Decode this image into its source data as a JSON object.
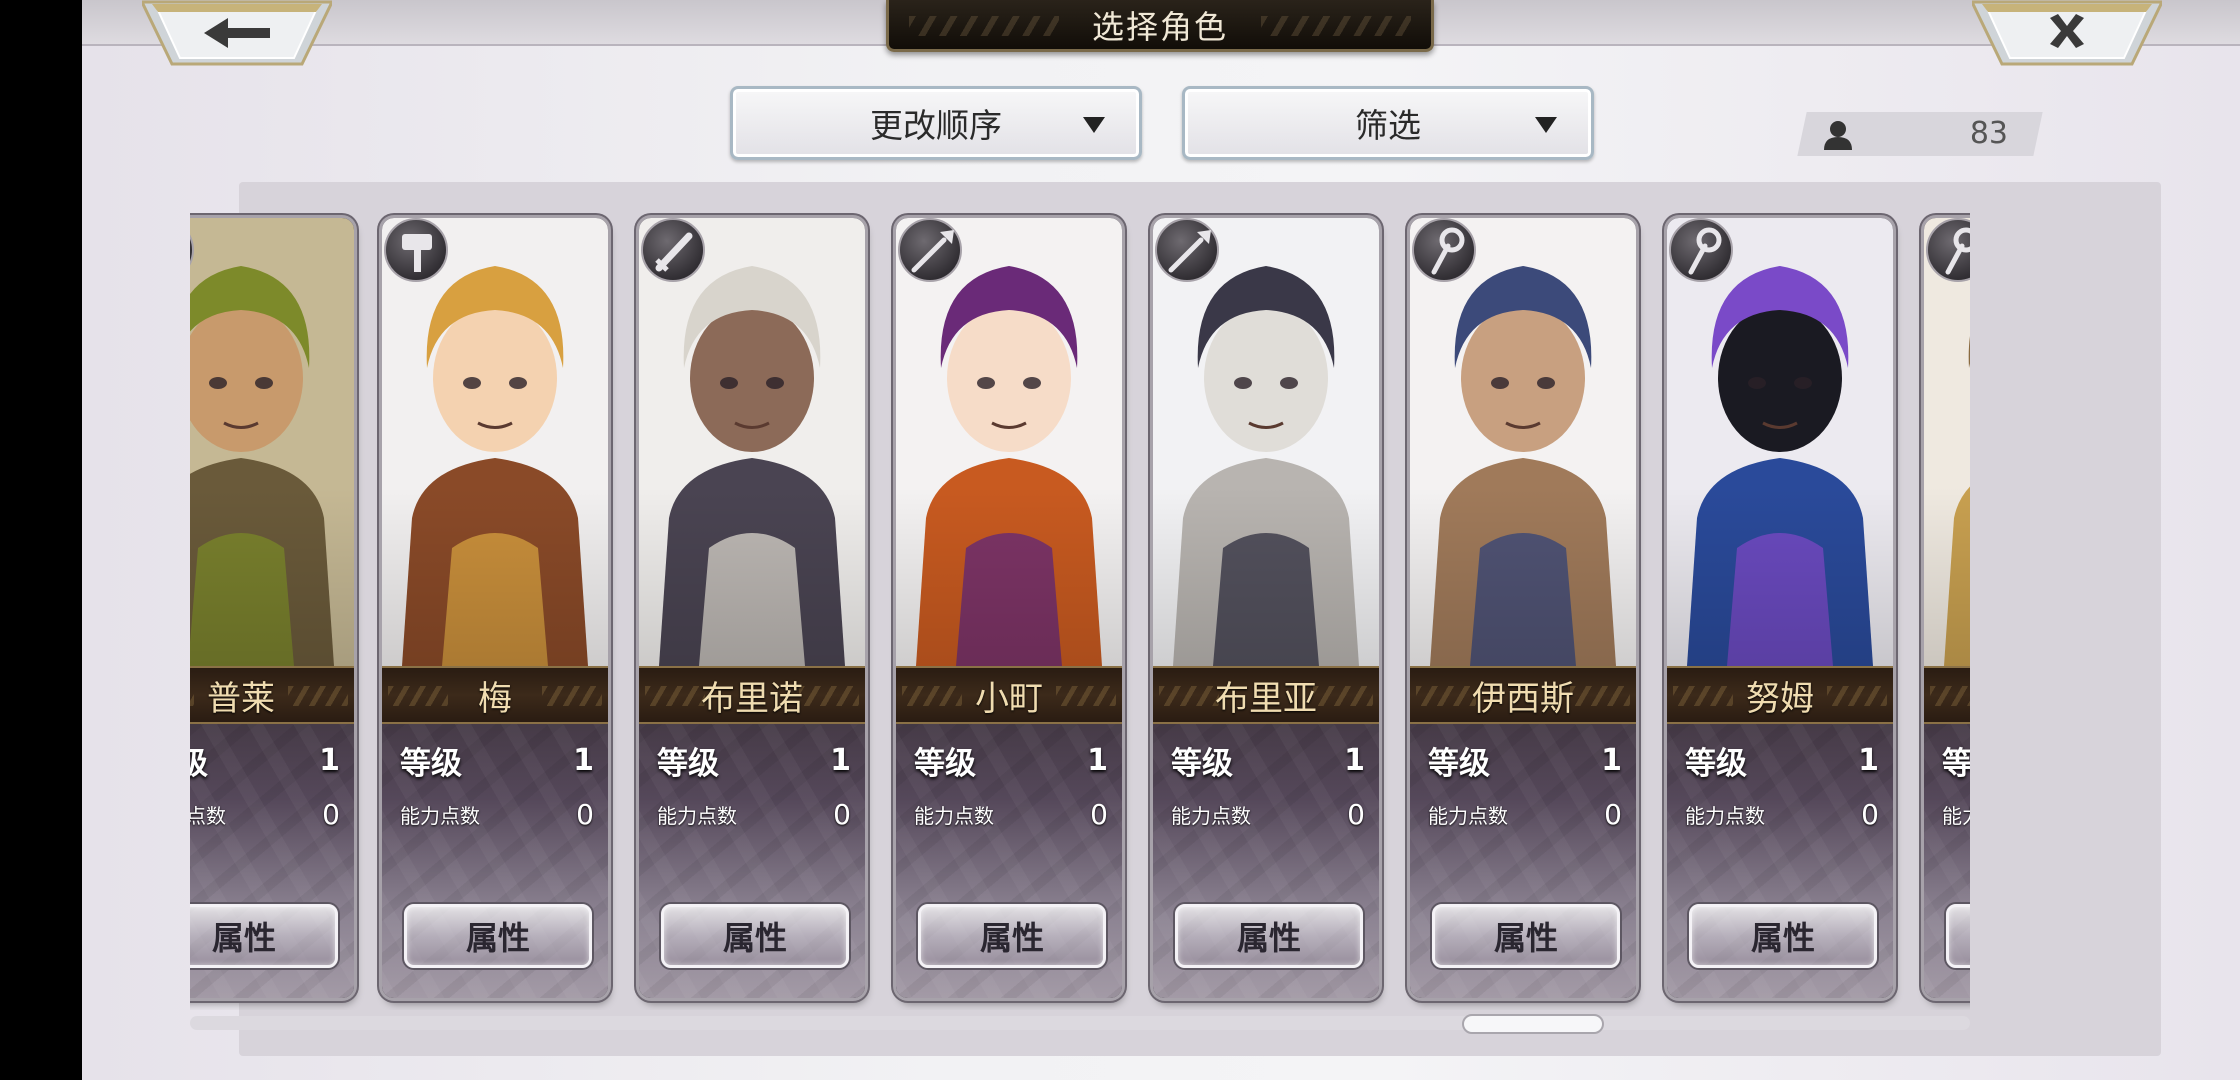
{
  "header": {
    "title": "选择角色",
    "back_icon": "arrow-left",
    "close_icon": "close-x"
  },
  "controls": {
    "sort_label": "更改顺序",
    "filter_label": "筛选"
  },
  "counter": {
    "icon": "person-icon",
    "value": "83"
  },
  "card_labels": {
    "level": "等级",
    "ability_points": "能力点数",
    "attributes_button": "属性"
  },
  "characters": [
    {
      "name": "普莱",
      "level": "1",
      "ability_points": "0",
      "weapon_icon": "spear-icon",
      "portrait": {
        "bg": "#c5b894",
        "main": "#6a5a3a",
        "accent": "#7d8a2a",
        "skin": "#c89a6c"
      }
    },
    {
      "name": "梅",
      "level": "1",
      "ability_points": "0",
      "weapon_icon": "hammer-icon",
      "portrait": {
        "bg": "#f2f0f0",
        "main": "#8a4a28",
        "accent": "#d8a040",
        "skin": "#f4d2b0"
      }
    },
    {
      "name": "布里诺",
      "level": "1",
      "ability_points": "0",
      "weapon_icon": "sword-icon",
      "portrait": {
        "bg": "#f0eeec",
        "main": "#4a4452",
        "accent": "#d8d4cc",
        "skin": "#8c6a58"
      }
    },
    {
      "name": "小町",
      "level": "1",
      "ability_points": "0",
      "weapon_icon": "spear-icon",
      "portrait": {
        "bg": "#f4f2f2",
        "main": "#c85a20",
        "accent": "#6a2a78",
        "skin": "#f6dcc8"
      }
    },
    {
      "name": "布里亚",
      "level": "1",
      "ability_points": "0",
      "weapon_icon": "spear-icon",
      "portrait": {
        "bg": "#f2f2f4",
        "main": "#b8b4b0",
        "accent": "#3a3848",
        "skin": "#e0ddd8"
      }
    },
    {
      "name": "伊西斯",
      "level": "1",
      "ability_points": "0",
      "weapon_icon": "staff-icon",
      "portrait": {
        "bg": "#f4f2f2",
        "main": "#a07a5a",
        "accent": "#3c4a7a",
        "skin": "#c8a080"
      }
    },
    {
      "name": "努姆",
      "level": "1",
      "ability_points": "0",
      "weapon_icon": "staff-icon",
      "portrait": {
        "bg": "#eceaf0",
        "main": "#2a4a9a",
        "accent": "#7a4ac8",
        "skin": "#1a1a22"
      }
    },
    {
      "name": "",
      "level": "",
      "ability_points": "",
      "weapon_icon": "staff-icon",
      "portrait": {
        "bg": "#efe9e0",
        "main": "#c8a050",
        "accent": "#8a6a40",
        "skin": "#f0d0b0"
      }
    }
  ]
}
